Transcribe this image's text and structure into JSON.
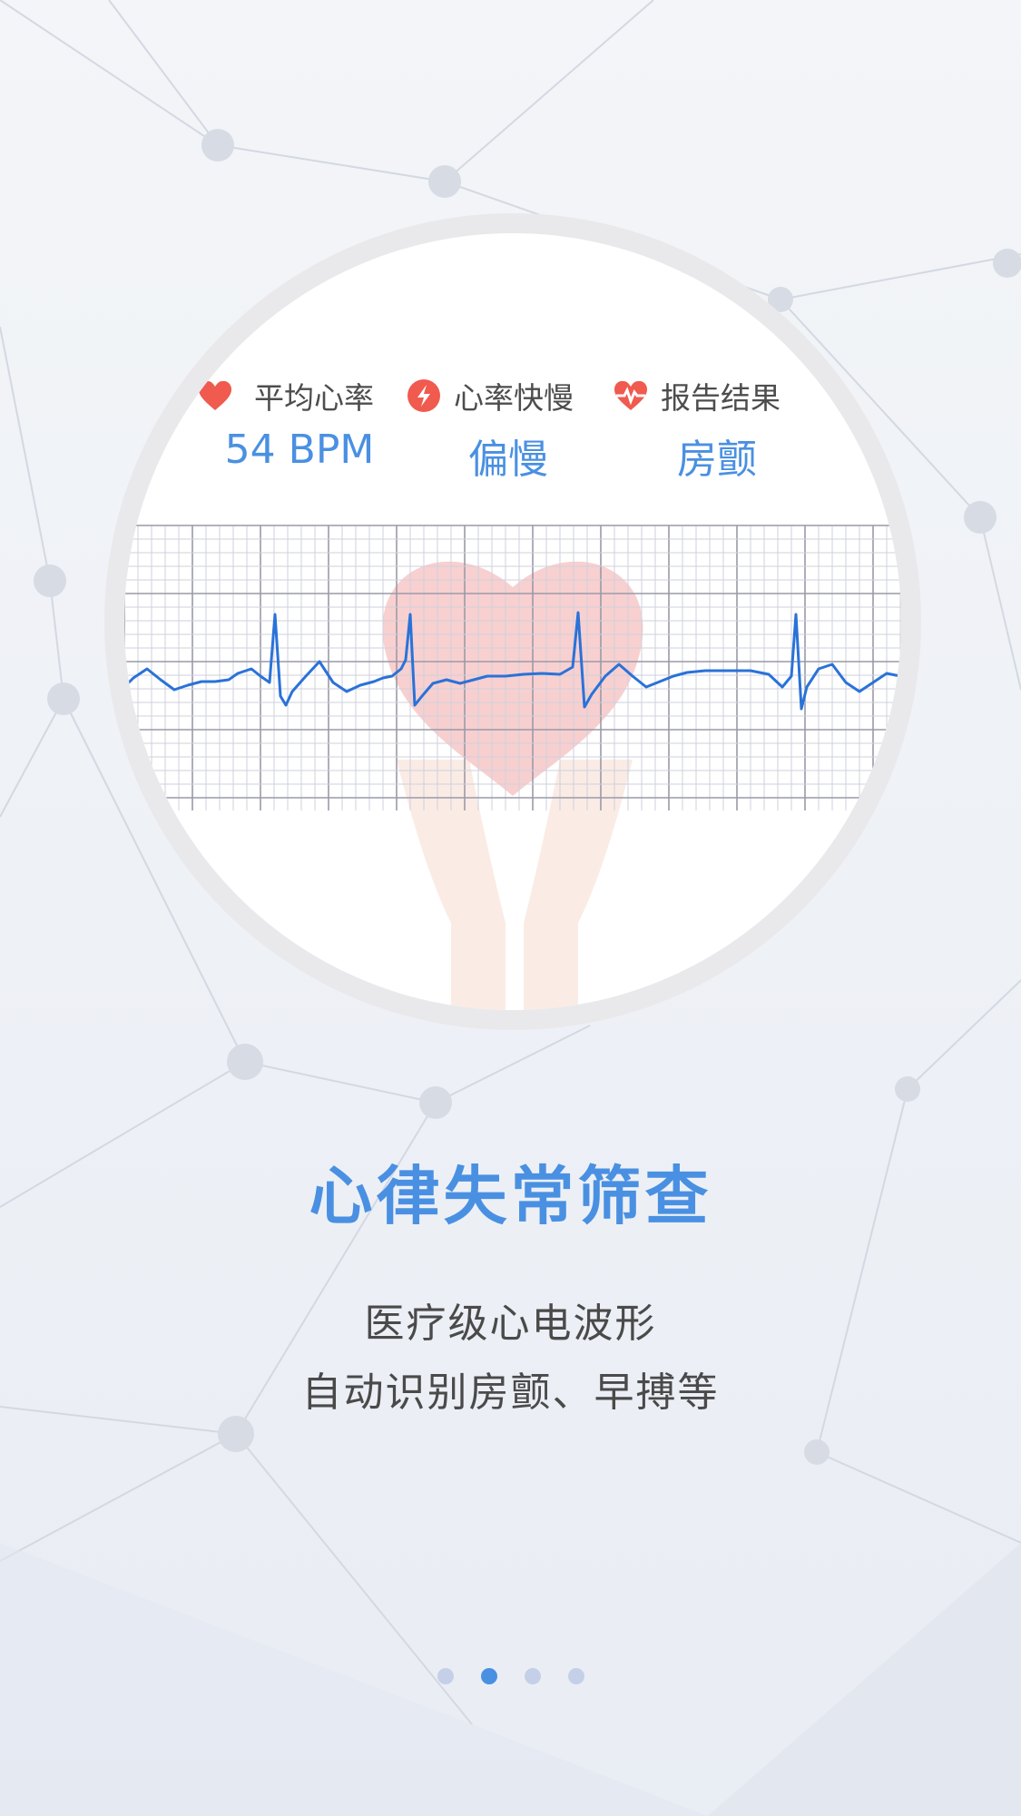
{
  "metrics": [
    {
      "label": "平均心率",
      "value": "54 BPM",
      "icon": "heart-icon"
    },
    {
      "label": "心率快慢",
      "value": "偏慢",
      "icon": "lightning-icon"
    },
    {
      "label": "报告结果",
      "value": "房颤",
      "icon": "heartbeat-icon"
    }
  ],
  "headline": "心律失常筛查",
  "description": [
    "医疗级心电波形",
    "自动识别房颤、早搏等"
  ],
  "pagination": {
    "total": 4,
    "active_index": 1
  },
  "colors": {
    "accent": "#4a90e2",
    "icon_red": "#f05a4f",
    "grid": "#b8b8c8",
    "text": "#4a4a4a"
  }
}
